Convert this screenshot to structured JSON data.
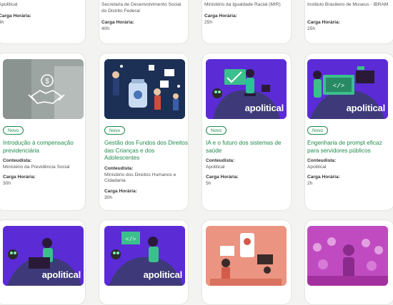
{
  "colors": {
    "accent": "#1f8a4c",
    "purple": "#5b2bd6"
  },
  "top_row": [
    {
      "meta": [
        {
          "label": "",
          "value": "Apolitical"
        },
        {
          "label": "Carga Horária:",
          "value": "4h"
        }
      ]
    },
    {
      "meta": [
        {
          "label": "",
          "value": "Secretaria de Desenvolvimento Social do Distrito Federal"
        },
        {
          "label": "Carga Horária:",
          "value": "40h"
        }
      ]
    },
    {
      "meta": [
        {
          "label": "",
          "value": "Ministério da Igualdade Racial (MIR)"
        },
        {
          "label": "Carga Horária:",
          "value": "25h"
        }
      ]
    },
    {
      "meta": [
        {
          "label": "",
          "value": "Instituto Brasileiro de Museus - IBRAM"
        },
        {
          "label": "Carga Horária:",
          "value": "25h"
        }
      ]
    }
  ],
  "cards": [
    {
      "badge": "Novo",
      "title": "Introdução à compensação previdenciária",
      "content_label": "Conteudista:",
      "content_value": "Ministério da Previdência Social",
      "hours_label": "Carga Horária:",
      "hours_value": "30h"
    },
    {
      "badge": "Novo",
      "title": "Gestão dos Fundos dos Direitos das Crianças e dos Adolescentes",
      "content_label": "Conteudista:",
      "content_value": "Ministério dos Direitos Humanos e Cidadania",
      "hours_label": "Carga Horária:",
      "hours_value": "30h"
    },
    {
      "badge": "Novo",
      "title": "IA e o futuro dos sistemas de saúde",
      "content_label": "Conteudista:",
      "content_value": "Apolitical",
      "hours_label": "Carga Horária:",
      "hours_value": "5h",
      "brand": "apolitical"
    },
    {
      "badge": "Novo",
      "title": "Engenharia de prompt eficaz para servidores públicos",
      "content_label": "Conteudista:",
      "content_value": "Apolitical",
      "hours_label": "Carga Horária:",
      "hours_value": "2h",
      "brand": "apolitical"
    }
  ],
  "bottom_row": [
    {
      "brand": "apolitical"
    },
    {
      "brand": "apolitical"
    },
    {
      "brand": ""
    },
    {
      "brand": ""
    }
  ]
}
